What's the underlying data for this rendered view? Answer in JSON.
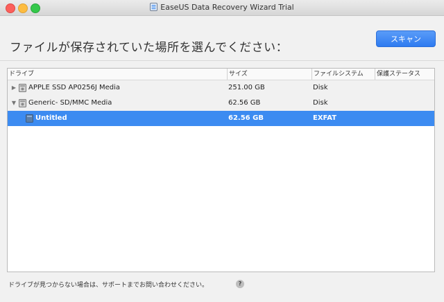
{
  "window": {
    "title": "EaseUS Data Recovery Wizard Trial"
  },
  "header": {
    "heading": "ファイルが保存されていた場所を選んでください：",
    "scan_label": "スキャン"
  },
  "table": {
    "columns": [
      "ドライブ",
      "サイズ",
      "ファイルシステム",
      "保護ステータス"
    ],
    "rows": [
      {
        "name": "APPLE SSD AP0256J Media",
        "size": "251.00 GB",
        "fs": "Disk",
        "status": "",
        "expander": "right",
        "selected": false
      },
      {
        "name": "Generic- SD/MMC Media",
        "size": "62.56 GB",
        "fs": "Disk",
        "status": "",
        "expander": "down",
        "selected": false
      },
      {
        "name": "Untitled",
        "size": "62.56 GB",
        "fs": "EXFAT",
        "status": "",
        "expander": "",
        "selected": true
      }
    ]
  },
  "footer": {
    "help_text": "ドライブが見つからない場合は、サポートまでお問い合わせください。",
    "help_button": "?"
  },
  "colors": {
    "accent": "#3c8bf1",
    "scan_button": "#2e7bf0"
  },
  "icons": [
    "app-icon",
    "disk-icon",
    "chevron-right-icon",
    "chevron-down-icon",
    "volume-icon",
    "help-icon"
  ]
}
